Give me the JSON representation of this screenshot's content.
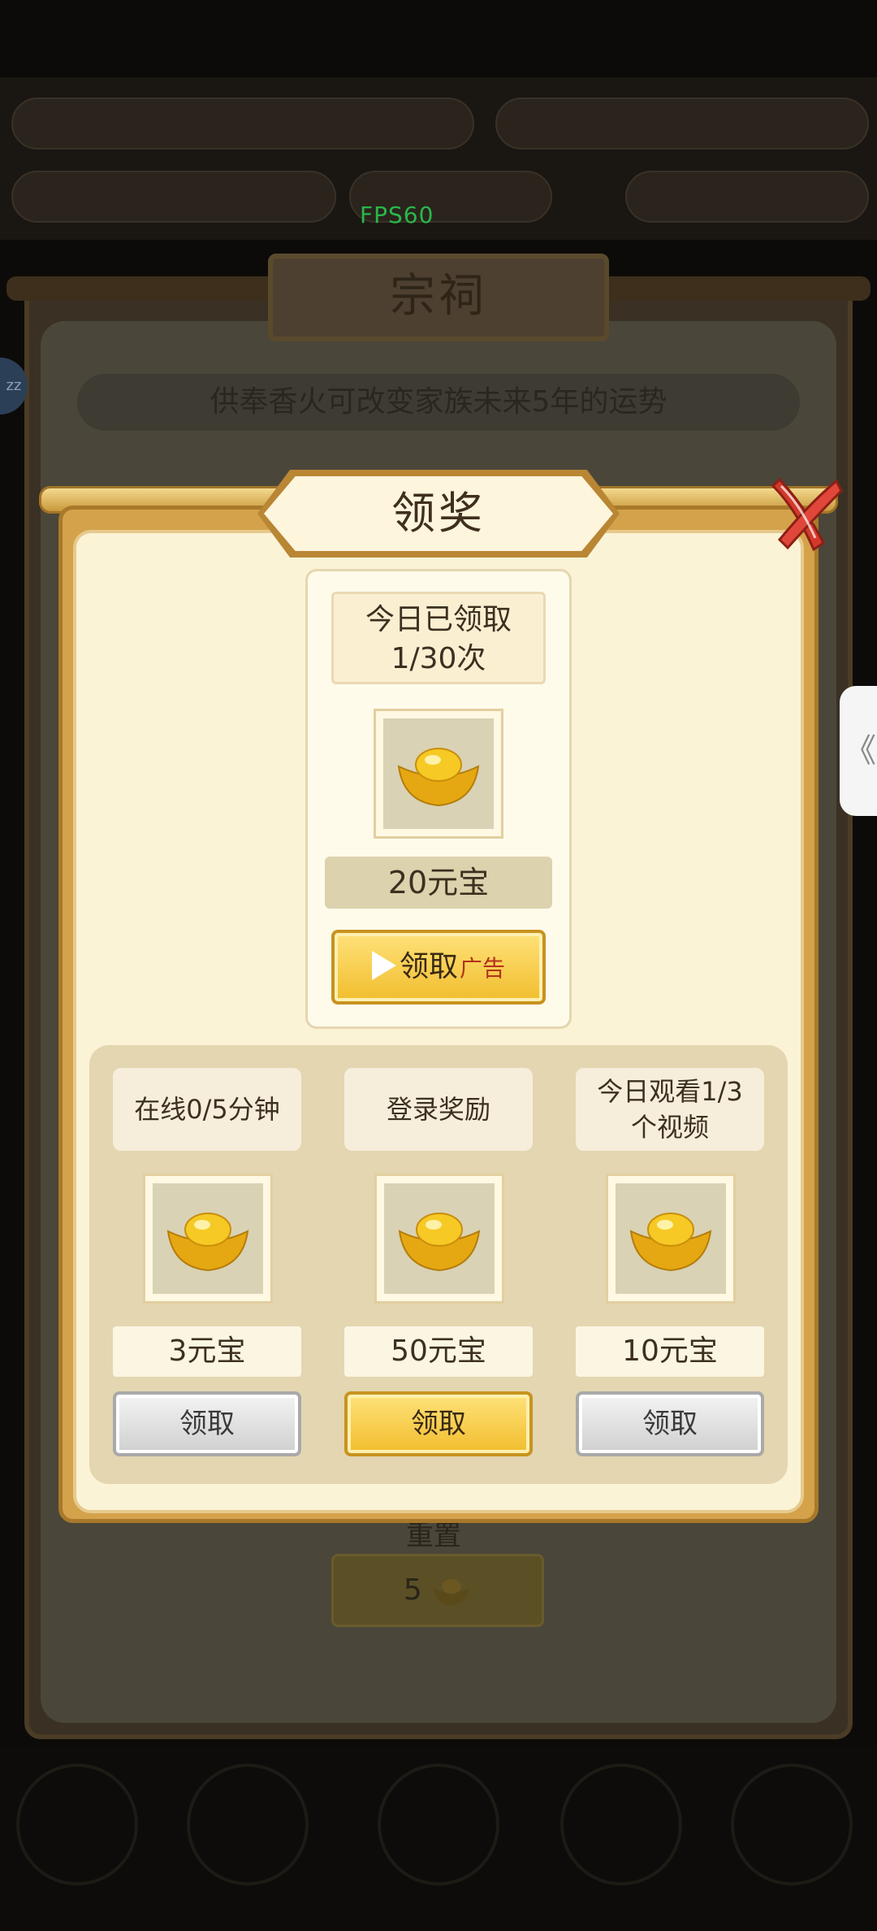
{
  "hud": {
    "fps": "FPS60"
  },
  "background": {
    "title": "宗祠",
    "subtitle": "供奉香火可改变家族未来5年的运势",
    "reset_label": "重置",
    "reset_cost": "5"
  },
  "dialog": {
    "title": "领奖",
    "main_reward": {
      "count_text": "今日已领取\n1/30次",
      "amount": "20元宝",
      "claim_label": "领取",
      "ad_tag": "广告"
    },
    "tasks": [
      {
        "label": "在线0/5分钟",
        "amount": "3元宝",
        "button": "领取",
        "state": "disabled"
      },
      {
        "label": "登录奖励",
        "amount": "50元宝",
        "button": "领取",
        "state": "active"
      },
      {
        "label": "今日观看1/3\n个视频",
        "amount": "10元宝",
        "button": "领取",
        "state": "disabled"
      }
    ]
  },
  "side_handle": {
    "icon": "chevron-left-icon",
    "glyph": "《"
  },
  "colors": {
    "gold": "#f1bd2d",
    "panel": "#fbf3d6",
    "frame": "#d4a24a",
    "close_red": "#d3392a"
  }
}
